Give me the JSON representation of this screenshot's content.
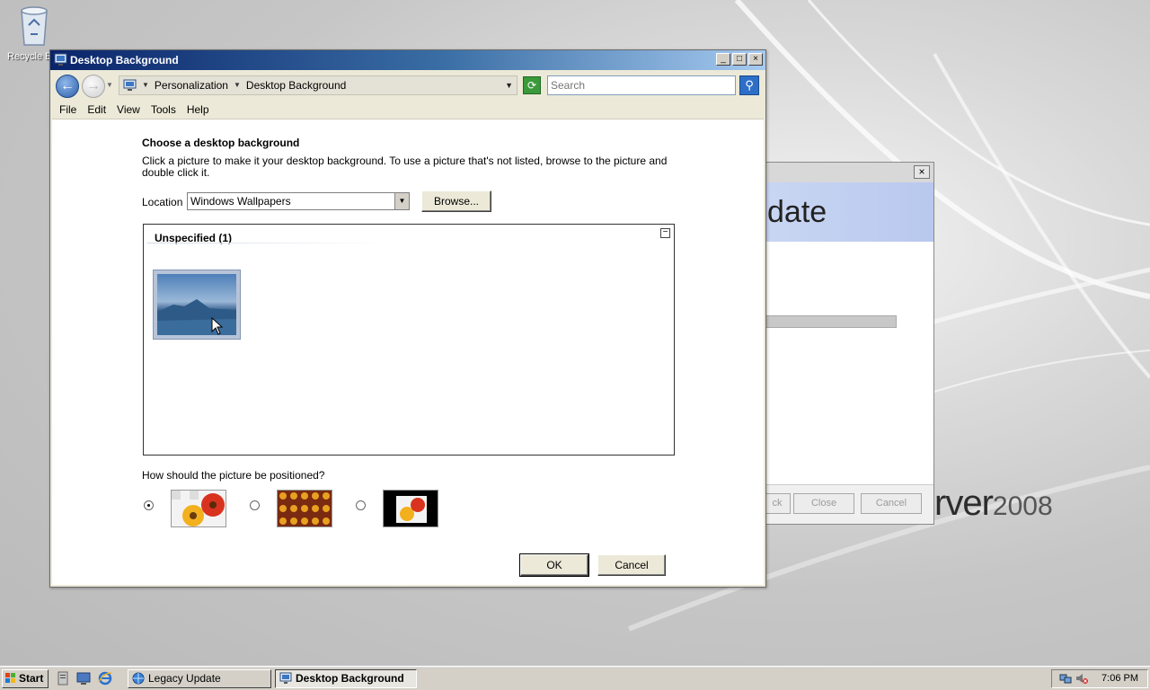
{
  "desktop": {
    "recycle_bin_label": "Recycle Bin",
    "brand_text": "rver",
    "brand_year": "2008"
  },
  "background_window": {
    "header_text": "date",
    "buttons": [
      "ck",
      "Close",
      "Cancel"
    ]
  },
  "window": {
    "title": "Desktop Background",
    "caption_buttons": [
      "_",
      "□",
      "×"
    ],
    "breadcrumb": [
      "Personalization",
      "Desktop Background"
    ],
    "search_placeholder": "Search",
    "menu": [
      "File",
      "Edit",
      "View",
      "Tools",
      "Help"
    ]
  },
  "content": {
    "heading": "Choose a desktop background",
    "description": "Click a picture to make it your desktop background. To use a picture that's not listed, browse to the picture and double click it.",
    "location_label": "Location",
    "location_value": "Windows Wallpapers",
    "browse_label": "Browse...",
    "group_header": "Unspecified (1)",
    "position_question": "How should the picture be positioned?",
    "position_options": [
      {
        "name": "fit-to-screen",
        "selected": true
      },
      {
        "name": "tile",
        "selected": false
      },
      {
        "name": "center",
        "selected": false
      }
    ],
    "ok_label": "OK",
    "cancel_label": "Cancel"
  },
  "taskbar": {
    "start_label": "Start",
    "tasks": [
      {
        "label": "Legacy Update",
        "active": false
      },
      {
        "label": "Desktop Background",
        "active": true
      }
    ],
    "clock": "7:06 PM"
  },
  "colors": {
    "title_bar_start": "#0a246a",
    "title_bar_end": "#a6caf0",
    "wizard_header": "#c9d6f3"
  }
}
